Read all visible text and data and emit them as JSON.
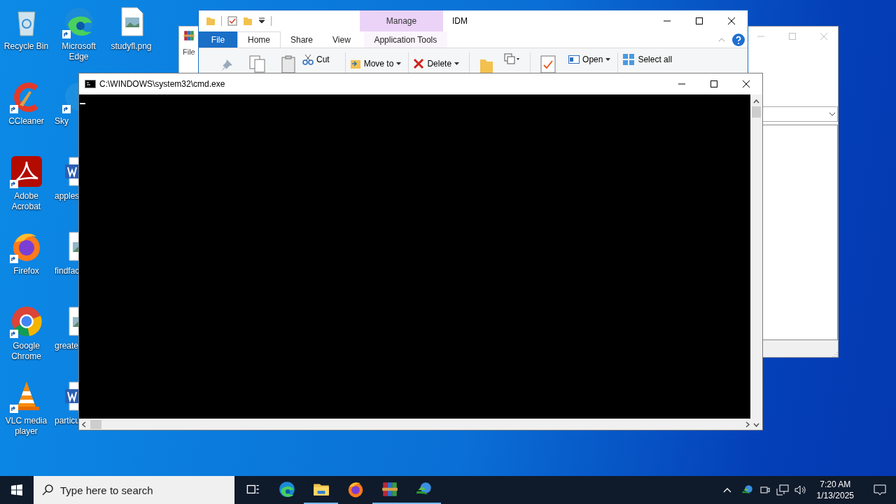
{
  "desktop": {
    "columns": [
      [
        {
          "label": "Recycle Bin",
          "kind": "recycle"
        },
        {
          "label": "CCleaner",
          "kind": "ccleaner"
        },
        {
          "label": "Adobe Acrobat",
          "kind": "acrobat"
        },
        {
          "label": "Firefox",
          "kind": "firefox"
        },
        {
          "label": "Google Chrome",
          "kind": "chrome"
        },
        {
          "label": "VLC media player",
          "kind": "vlc"
        }
      ],
      [
        {
          "label": "Microsoft Edge",
          "kind": "edge"
        },
        {
          "label": "Sky",
          "kind": "skype"
        },
        {
          "label": "apples",
          "kind": "word"
        },
        {
          "label": "findfac",
          "kind": "image"
        },
        {
          "label": "greate",
          "kind": "image"
        },
        {
          "label": "particu",
          "kind": "word"
        }
      ],
      [
        {
          "label": "studyfl.png",
          "kind": "image"
        }
      ]
    ]
  },
  "back_window": {
    "menu": "File"
  },
  "explorer": {
    "title": "IDM",
    "context_tab": "Manage",
    "tabs": [
      {
        "label": "File",
        "kind": "file",
        "selected": false
      },
      {
        "label": "Home",
        "kind": "tab",
        "selected": true
      },
      {
        "label": "Share",
        "kind": "tab",
        "selected": false
      },
      {
        "label": "View",
        "kind": "tab",
        "selected": false
      },
      {
        "label": "Application Tools",
        "kind": "context",
        "selected": false
      }
    ],
    "ribbon": [
      {
        "label": "Cut",
        "kind": "cut"
      },
      {
        "label": "Move to",
        "kind": "move"
      },
      {
        "label": "Delete",
        "kind": "delete"
      },
      {
        "label": "Open",
        "kind": "open"
      },
      {
        "label": "Select all",
        "kind": "selectall"
      }
    ]
  },
  "cmd": {
    "title": "C:\\WINDOWS\\system32\\cmd.exe"
  },
  "taskbar": {
    "search_placeholder": "Type here to search",
    "apps": [
      {
        "kind": "taskview",
        "running": false
      },
      {
        "kind": "edge",
        "running": false
      },
      {
        "kind": "explorer",
        "running": true
      },
      {
        "kind": "firefox",
        "running": false
      },
      {
        "kind": "winrar",
        "running": true
      },
      {
        "kind": "idm",
        "running": true
      }
    ],
    "time": "7:20 AM",
    "date": "1/13/2025"
  }
}
